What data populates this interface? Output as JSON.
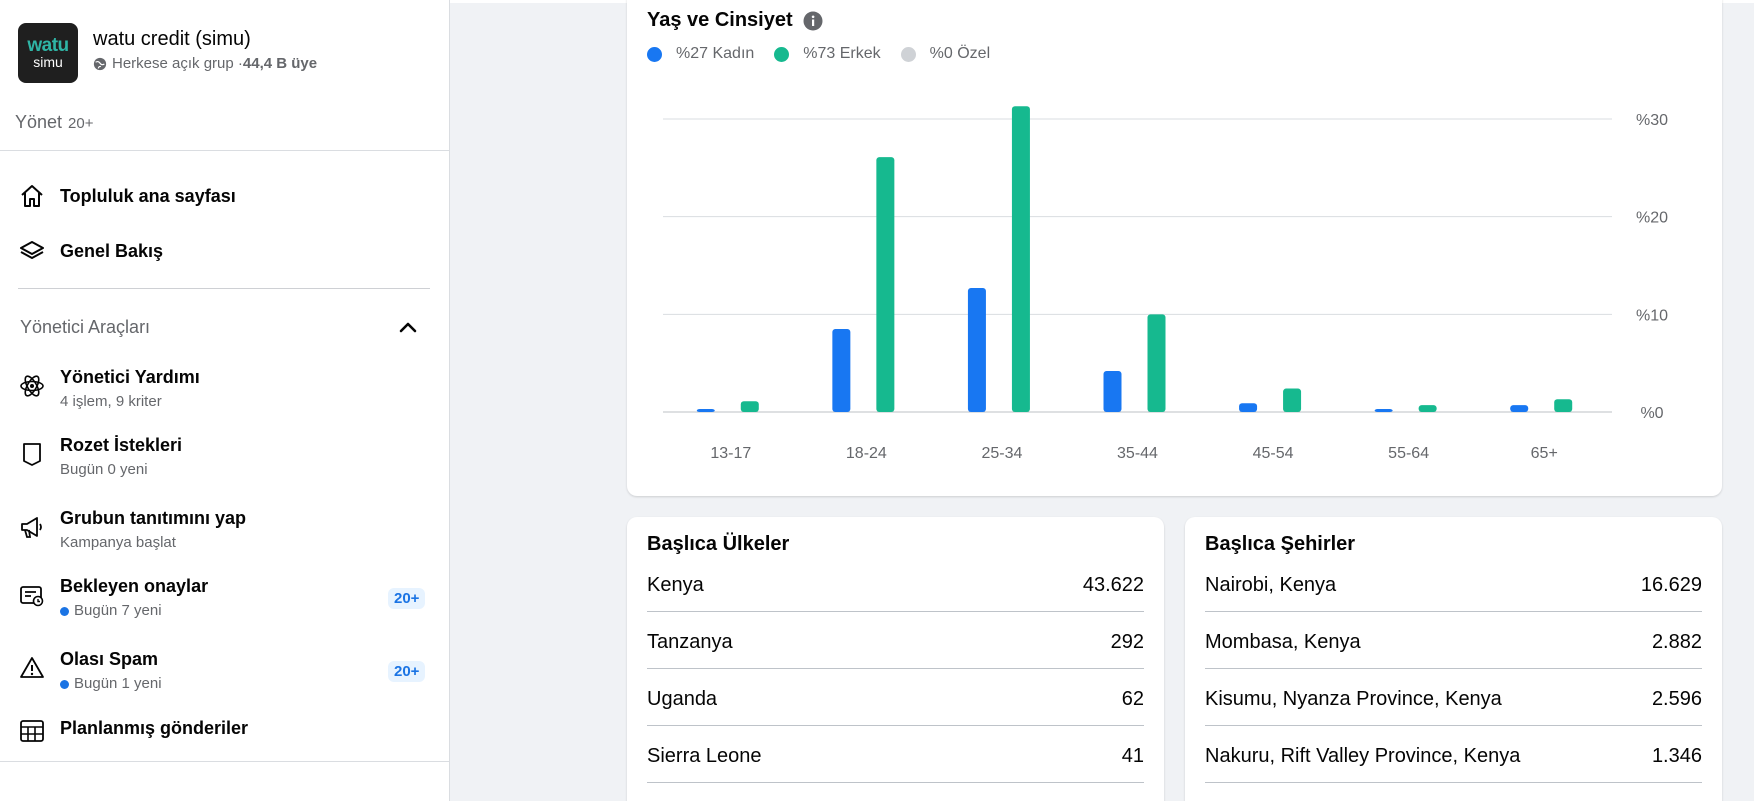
{
  "group": {
    "logo_line1": "watu",
    "logo_line2": "simu",
    "name": "watu credit (simu)",
    "privacy": "Herkese açık grup · ",
    "members": "44,4 B üye"
  },
  "manage": {
    "label": "Yönet",
    "count": "20+"
  },
  "nav": [
    {
      "label": "Topluluk ana sayfası",
      "icon": "home-icon"
    },
    {
      "label": "Genel Bakış",
      "icon": "layers-icon"
    }
  ],
  "admin_tools": {
    "title": "Yönetici Araçları",
    "items": [
      {
        "title": "Yönetici Yardımı",
        "subtitle": "4 işlem, 9 kriter",
        "icon": "atom-icon"
      },
      {
        "title": "Rozet İstekleri",
        "subtitle": "Bugün 0 yeni",
        "icon": "badge-shield-icon"
      },
      {
        "title": "Grubun tanıtımını yap",
        "subtitle": "Kampanya başlat",
        "icon": "megaphone-icon"
      },
      {
        "title": "Bekleyen onaylar",
        "subtitle": "Bugün 7 yeni",
        "icon": "pending-icon",
        "badge": "20+",
        "dot": true
      },
      {
        "title": "Olası Spam",
        "subtitle": "Bugün 1 yeni",
        "icon": "warning-icon",
        "badge": "20+",
        "dot": true
      },
      {
        "title": "Planlanmış gönderiler",
        "subtitle": "",
        "icon": "calendar-icon"
      }
    ]
  },
  "colors": {
    "female": "#1877f2",
    "male": "#16b98f",
    "other": "#cfd2d6",
    "badge_bg": "#e7f3ff"
  },
  "chart_data": {
    "type": "bar",
    "title": "Yaş ve Cinsiyet",
    "categories": [
      "13-17",
      "18-24",
      "25-34",
      "35-44",
      "45-54",
      "55-64",
      "65+"
    ],
    "series": [
      {
        "name": "%27 Kadın",
        "values": [
          0.3,
          8.5,
          12.7,
          4.2,
          0.9,
          0.3,
          0.7
        ]
      },
      {
        "name": "%73 Erkek",
        "values": [
          1.1,
          26.1,
          31.3,
          10.0,
          2.4,
          0.7,
          1.3
        ]
      },
      {
        "name": "%0 Özel",
        "values": [
          0,
          0,
          0,
          0,
          0,
          0,
          0
        ]
      }
    ],
    "yticks": [
      "%0",
      "%10",
      "%20",
      "%30"
    ],
    "ylim": [
      0,
      30
    ],
    "grid": true,
    "legend": "top-left"
  },
  "countries": {
    "title": "Başlıca Ülkeler",
    "rows": [
      {
        "name": "Kenya",
        "value": "43.622"
      },
      {
        "name": "Tanzanya",
        "value": "292"
      },
      {
        "name": "Uganda",
        "value": "62"
      },
      {
        "name": "Sierra Leone",
        "value": "41"
      }
    ]
  },
  "cities": {
    "title": "Başlıca Şehirler",
    "rows": [
      {
        "name": "Nairobi, Kenya",
        "value": "16.629"
      },
      {
        "name": "Mombasa, Kenya",
        "value": "2.882"
      },
      {
        "name": "Kisumu, Nyanza Province, Kenya",
        "value": "2.596"
      },
      {
        "name": "Nakuru, Rift Valley Province, Kenya",
        "value": "1.346"
      }
    ]
  }
}
